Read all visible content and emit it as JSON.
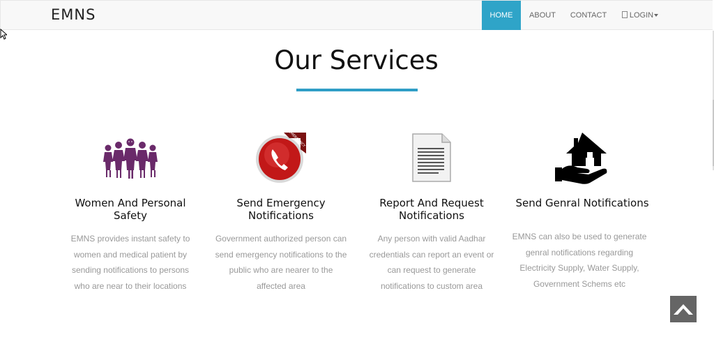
{
  "brand": "EMNS",
  "nav": {
    "home": "HOME",
    "about": "ABOUT",
    "contact": "CONTACT",
    "login": "LOGIN",
    "login_icon": "user-icon",
    "active_color": "#2fa4c8"
  },
  "section": {
    "title": "Our Services",
    "accent": "#2f9ec6"
  },
  "services": [
    {
      "icon": "women-group-icon",
      "title_line1": "Women And Personal",
      "title_line2": "Safety",
      "desc": [
        "EMNS provides instant safety to",
        "women and medical patient by",
        "sending notifications to persons",
        "who are near to their locations"
      ]
    },
    {
      "icon": "emergency-phone-icon",
      "title_line1": "Send Emergency",
      "title_line2": "Notifications",
      "badge": "EMERGENCY",
      "desc": [
        "Government authorized person can",
        "send emergency notifications to the",
        "public who are nearer to the",
        "affected area"
      ]
    },
    {
      "icon": "document-icon",
      "title_line1": "Report And Request",
      "title_line2": "Notifications",
      "desc": [
        "Any person with valid Aadhar",
        "credentials can report an event or",
        "can request to generate",
        "notifications to custom area"
      ]
    },
    {
      "icon": "house-hand-icon",
      "title_line1": "Send Genral Notifications",
      "title_line2": "",
      "desc": [
        "EMNS can also be used to generate",
        "genral notifications regarding",
        "Electricity Supply, Water Supply,",
        "Government Schems etc"
      ]
    }
  ],
  "back_to_top": "chevron-up-icon"
}
